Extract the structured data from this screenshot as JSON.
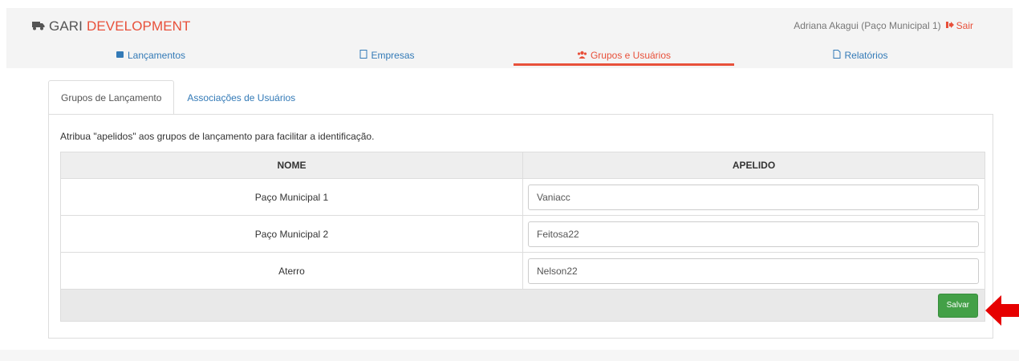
{
  "header": {
    "brand_primary": "GARI",
    "brand_secondary": "DEVELOPMENT",
    "user_label": "Adriana Akagui (Paço Municipal 1)",
    "logout_label": "Sair"
  },
  "nav": {
    "items": [
      {
        "label": "Lançamentos",
        "icon": "rocket-icon"
      },
      {
        "label": "Empresas",
        "icon": "building-icon"
      },
      {
        "label": "Grupos e Usuários",
        "icon": "users-icon",
        "active": true
      },
      {
        "label": "Relatórios",
        "icon": "file-icon"
      }
    ]
  },
  "tabs": [
    {
      "label": "Grupos de Lançamento",
      "active": true
    },
    {
      "label": "Associações de Usuários",
      "active": false
    }
  ],
  "main": {
    "hint": "Atribua \"apelidos\" aos grupos de lançamento para facilitar a identificação.",
    "table": {
      "headers": [
        "NOME",
        "APELIDO"
      ],
      "rows": [
        {
          "nome": "Paço Municipal 1",
          "apelido": "Vaniacc"
        },
        {
          "nome": "Paço Municipal 2",
          "apelido": "Feitosa22"
        },
        {
          "nome": "Aterro",
          "apelido": "Nelson22"
        }
      ]
    },
    "save_label": "Salvar"
  },
  "colors": {
    "accent": "#e8503a",
    "link": "#337ab7",
    "save_button": "#43a047",
    "arrow": "#e60000"
  }
}
